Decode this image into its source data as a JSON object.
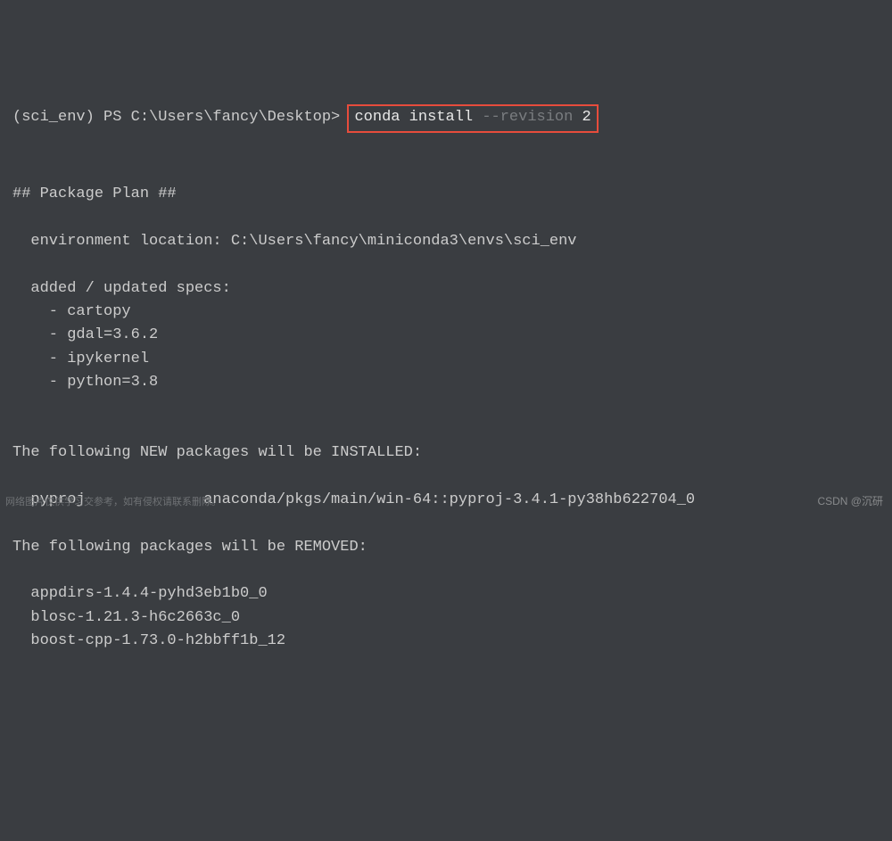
{
  "prompt": {
    "prefix": "(sci_env) PS C:\\Users\\fancy\\Desktop> ",
    "cmd_part1": "conda",
    "cmd_part2": " install ",
    "cmd_flag": "--revision",
    "cmd_part3": " 2"
  },
  "output": {
    "plan_header": "## Package Plan ##",
    "env_location": "  environment location: C:\\Users\\fancy\\miniconda3\\envs\\sci_env",
    "specs_header": "  added / updated specs:",
    "specs": [
      "    - cartopy",
      "    - gdal=3.6.2",
      "    - ipykernel",
      "    - python=3.8"
    ],
    "new_packages_header": "The following NEW packages will be INSTALLED:",
    "new_packages": [
      "  pyproj             anaconda/pkgs/main/win-64::pyproj-3.4.1-py38hb622704_0"
    ],
    "removed_header": "The following packages will be REMOVED:",
    "removed_packages": [
      "  appdirs-1.4.4-pyhd3eb1b0_0",
      "  blosc-1.21.3-h6c2663c_0",
      "  boost-cpp-1.73.0-h2bbff1b_12"
    ]
  },
  "watermarks": {
    "left": "网络图片仅供学习交参考，如有侵权请联系删除。",
    "right": "CSDN @沉研"
  }
}
